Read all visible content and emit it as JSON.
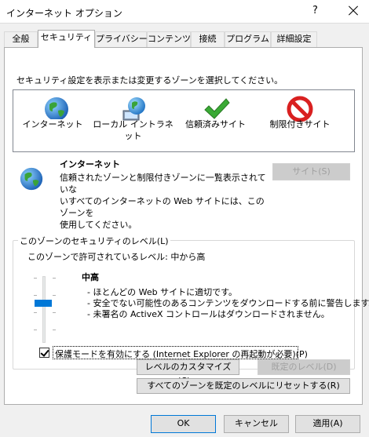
{
  "window": {
    "title": "インターネット オプション",
    "help": "?",
    "close_label": "×"
  },
  "tabs": [
    {
      "label": "全般"
    },
    {
      "label": "セキュリティ"
    },
    {
      "label": "プライバシー"
    },
    {
      "label": "コンテンツ"
    },
    {
      "label": "接続"
    },
    {
      "label": "プログラム"
    },
    {
      "label": "詳細設定"
    }
  ],
  "security": {
    "prompt": "セキュリティ設定を表示または変更するゾーンを選択してください。",
    "zones": [
      {
        "label": "インターネット",
        "icon": "globe-icon"
      },
      {
        "label": "ローカル イントラネット",
        "icon": "intranet-globe-icon"
      },
      {
        "label": "信頼済みサイト",
        "icon": "checkmark-icon"
      },
      {
        "label": "制限付きサイト",
        "icon": "prohibited-icon"
      }
    ],
    "selected_zone": {
      "title": "インターネット",
      "desc_lines": [
        "信頼されたゾーンと制限付きゾーンに一覧表示されていな",
        "いすべてのインターネットの Web サイトには、このゾーンを",
        "使用してください。"
      ]
    },
    "sites_button": "サイト(S)",
    "level_group": {
      "legend": "このゾーンのセキュリティのレベル(L)",
      "allowed_level": "このゾーンで許可されているレベル: 中から高",
      "level_name": "中高",
      "bullets": [
        "- ほとんどの Web サイトに適切です。",
        "- 安全でない可能性のあるコンテンツをダウンロードする前に警告します。",
        "- 未署名の ActiveX コントロールはダウンロードされません。"
      ]
    },
    "protected_mode_label": "保護モードを有効にする (Internet Explorer の再起動が必要)(P)",
    "custom_level_button": "レベルのカスタマイズ(C)...",
    "default_level_button": "既定のレベル(D)",
    "reset_all_button": "すべてのゾーンを既定のレベルにリセットする(R)"
  },
  "footer": {
    "ok": "OK",
    "cancel": "キャンセル",
    "apply": "適用(A)"
  },
  "colors": {
    "accent": "#0078d7",
    "prohibited": "#d92020",
    "check": "#3aaa35"
  }
}
